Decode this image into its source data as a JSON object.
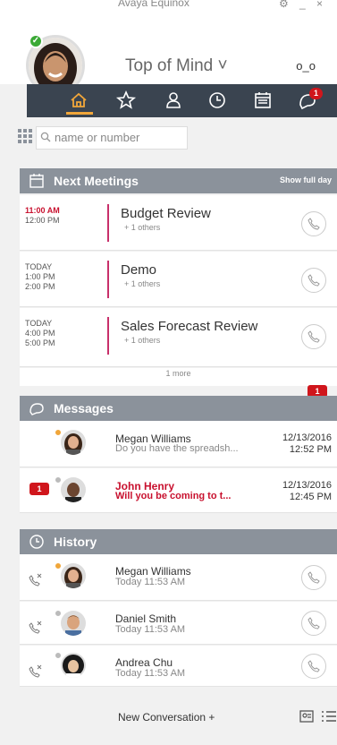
{
  "window": {
    "title": "Avaya Equinox",
    "gear": "gear-icon",
    "minimize": "_",
    "close": "×"
  },
  "header": {
    "title": "Top of Mind ˅",
    "voicemail": "o_o"
  },
  "tabs": {
    "chat_badge": "1"
  },
  "search": {
    "placeholder": "name or number"
  },
  "meetings": {
    "header": "Next Meetings",
    "action": "Show full day",
    "items": [
      {
        "t1": "11:00 AM",
        "t2": "12:00 PM",
        "t3": "",
        "title": "Budget Review",
        "sub": "+ 1 others"
      },
      {
        "t1": "TODAY",
        "t2": "1:00 PM",
        "t3": "2:00 PM",
        "title": "Demo",
        "sub": "+ 1 others"
      },
      {
        "t1": "TODAY",
        "t2": "4:00 PM",
        "t3": "5:00 PM",
        "title": "Sales Forecast Review",
        "sub": "+ 1 others"
      }
    ],
    "more": "1 more"
  },
  "messages": {
    "header": "Messages",
    "badge": "1",
    "items": [
      {
        "name": "Megan Williams",
        "text": "Do you have the spreadsh...",
        "date": "12/13/2016",
        "time": "12:52 PM"
      },
      {
        "name": "John Henry",
        "text": "Will you be coming to t...",
        "date": "12/13/2016",
        "time": "12:45 PM",
        "badge": "1"
      }
    ]
  },
  "history": {
    "header": "History",
    "items": [
      {
        "name": "Megan Williams",
        "time": "Today 11:53 AM"
      },
      {
        "name": "Daniel Smith",
        "time": "Today 11:53 AM"
      },
      {
        "name": "Andrea Chu",
        "time": "Today 11:53 AM"
      }
    ]
  },
  "footer": {
    "new": "New Conversation +"
  },
  "colors": {
    "tabbar": "#3a4450",
    "accent": "#f0a63a",
    "section": "#8b929b",
    "alert": "#d0161c"
  }
}
